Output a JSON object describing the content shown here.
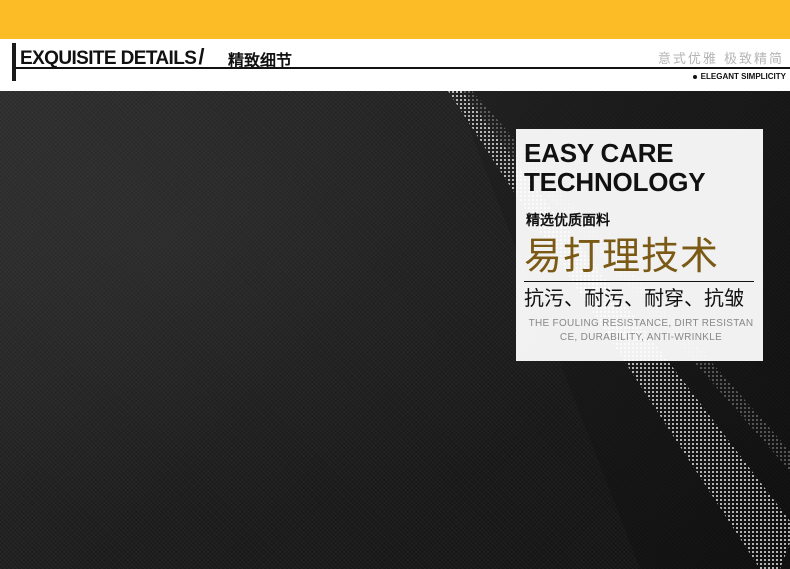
{
  "header": {
    "title_en": "EXQUISITE DETAILS",
    "slash": "/",
    "title_cn": "精致细节",
    "slogan_cn": "意式优雅 极致精简",
    "slogan_en": "ELEGANT SIMPLICITY"
  },
  "card": {
    "title_line1": "EASY CARE",
    "title_line2": "TECHNOLOGY",
    "subtitle": "精选优质面料",
    "headline": "易打理技术",
    "features": "抗污、耐污、耐穿、抗皱",
    "desc_line1": "THE FOULING RESISTANCE, DIRT RESISTAN",
    "desc_line2": "CE, DURABILITY, ANTI-WRINKLE"
  },
  "colors": {
    "top_bar": "#fcbc25",
    "headline": "#7a5a14",
    "fabric": "#1b1b1b"
  }
}
